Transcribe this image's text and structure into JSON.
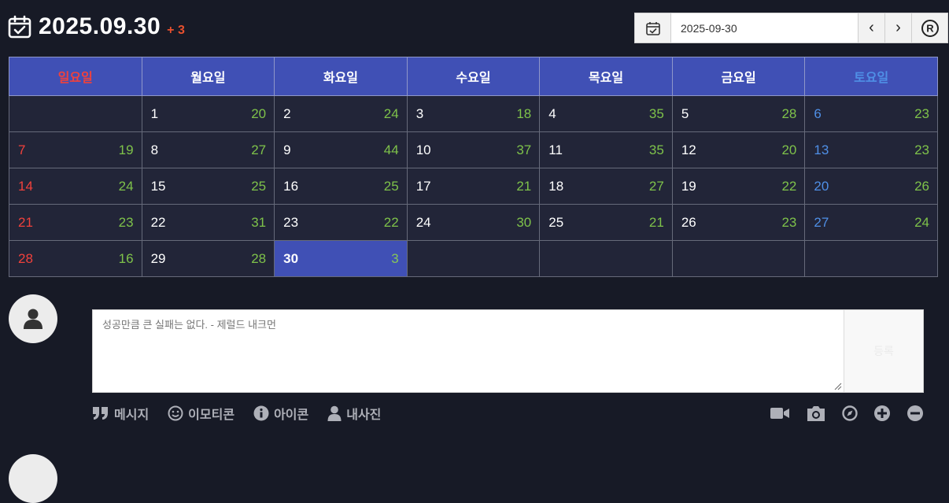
{
  "header": {
    "date": "2025.09.30",
    "extra": "+ 3"
  },
  "date_input": {
    "value": "2025-09-30"
  },
  "nav": {
    "prev": "‹",
    "next": "›",
    "reset": "®"
  },
  "weekdays": [
    "일요일",
    "월요일",
    "화요일",
    "수요일",
    "목요일",
    "금요일",
    "토요일"
  ],
  "weeks": [
    [
      {
        "d": "",
        "n": ""
      },
      {
        "d": "1",
        "n": "20"
      },
      {
        "d": "2",
        "n": "24"
      },
      {
        "d": "3",
        "n": "18"
      },
      {
        "d": "4",
        "n": "35"
      },
      {
        "d": "5",
        "n": "28"
      },
      {
        "d": "6",
        "n": "23"
      }
    ],
    [
      {
        "d": "7",
        "n": "19"
      },
      {
        "d": "8",
        "n": "27"
      },
      {
        "d": "9",
        "n": "44"
      },
      {
        "d": "10",
        "n": "37"
      },
      {
        "d": "11",
        "n": "35"
      },
      {
        "d": "12",
        "n": "20"
      },
      {
        "d": "13",
        "n": "23"
      }
    ],
    [
      {
        "d": "14",
        "n": "24"
      },
      {
        "d": "15",
        "n": "25"
      },
      {
        "d": "16",
        "n": "25"
      },
      {
        "d": "17",
        "n": "21"
      },
      {
        "d": "18",
        "n": "27"
      },
      {
        "d": "19",
        "n": "22"
      },
      {
        "d": "20",
        "n": "26"
      }
    ],
    [
      {
        "d": "21",
        "n": "23"
      },
      {
        "d": "22",
        "n": "31"
      },
      {
        "d": "23",
        "n": "22"
      },
      {
        "d": "24",
        "n": "30"
      },
      {
        "d": "25",
        "n": "21"
      },
      {
        "d": "26",
        "n": "23"
      },
      {
        "d": "27",
        "n": "24"
      }
    ],
    [
      {
        "d": "28",
        "n": "16"
      },
      {
        "d": "29",
        "n": "28"
      },
      {
        "d": "30",
        "n": "3"
      },
      {
        "d": "",
        "n": ""
      },
      {
        "d": "",
        "n": ""
      },
      {
        "d": "",
        "n": ""
      },
      {
        "d": "",
        "n": ""
      }
    ]
  ],
  "today": "30",
  "comment": {
    "placeholder": "성공만큼 큰 실패는 없다. - 제럴드 내크먼",
    "submit": "등록"
  },
  "toolbar": {
    "message": "메시지",
    "emoticon": "이모티콘",
    "icon": "아이콘",
    "myphoto": "내사진"
  },
  "icons_right": [
    "video-icon",
    "camera-icon",
    "compass-icon",
    "plus-circle-icon",
    "minus-circle-icon"
  ],
  "colors": {
    "accent": "#4050b5",
    "sunday": "#f0413c",
    "saturday": "#4f8fe6",
    "count": "#7ec24a",
    "bg": "#171a26"
  }
}
